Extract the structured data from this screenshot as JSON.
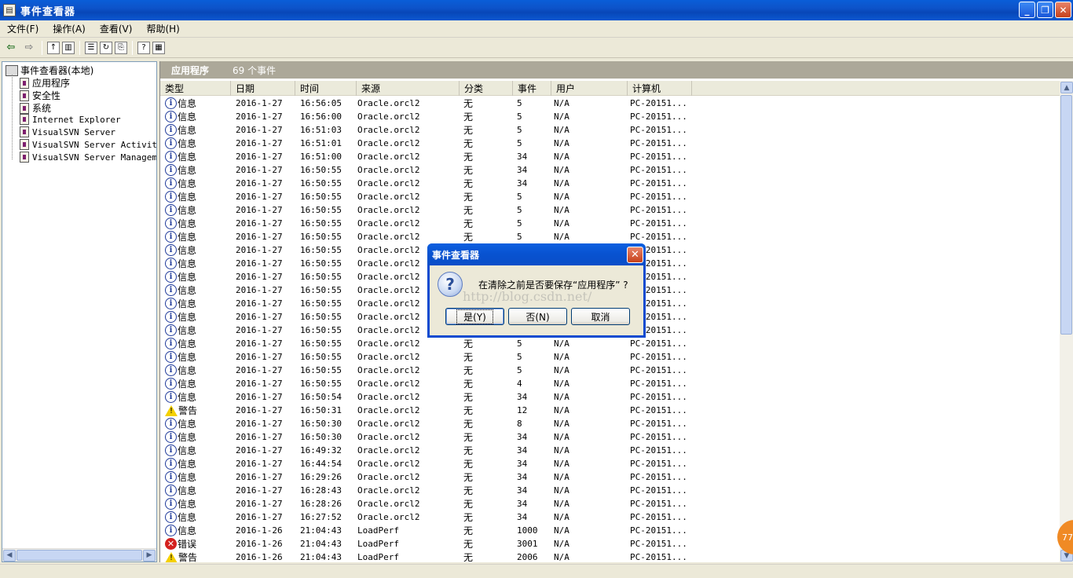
{
  "window": {
    "title": "事件查看器"
  },
  "menu": [
    "文件(F)",
    "操作(A)",
    "查看(V)",
    "帮助(H)"
  ],
  "toolbar": {
    "icons": [
      "back-arrow-icon",
      "forward-arrow-icon",
      "up-folder-icon",
      "show-hide-tree-icon",
      "properties-icon",
      "refresh-icon",
      "export-list-icon",
      "help-icon",
      "console-icon"
    ]
  },
  "tree": {
    "root": "事件查看器(本地)",
    "items": [
      "应用程序",
      "安全性",
      "系统",
      "Internet Explorer",
      "VisualSVN Server",
      "VisualSVN Server Activity",
      "VisualSVN Server Management"
    ]
  },
  "pane": {
    "title": "应用程序",
    "count": "69 个事件"
  },
  "columns": [
    "类型",
    "日期",
    "时间",
    "来源",
    "分类",
    "事件",
    "用户",
    "计算机"
  ],
  "rows": [
    {
      "type": "信息",
      "icon": "info",
      "date": "2016-1-27",
      "time": "16:56:05",
      "source": "Oracle.orcl2",
      "category": "无",
      "event": "5",
      "user": "N/A",
      "computer": "PC-20151..."
    },
    {
      "type": "信息",
      "icon": "info",
      "date": "2016-1-27",
      "time": "16:56:00",
      "source": "Oracle.orcl2",
      "category": "无",
      "event": "5",
      "user": "N/A",
      "computer": "PC-20151..."
    },
    {
      "type": "信息",
      "icon": "info",
      "date": "2016-1-27",
      "time": "16:51:03",
      "source": "Oracle.orcl2",
      "category": "无",
      "event": "5",
      "user": "N/A",
      "computer": "PC-20151..."
    },
    {
      "type": "信息",
      "icon": "info",
      "date": "2016-1-27",
      "time": "16:51:01",
      "source": "Oracle.orcl2",
      "category": "无",
      "event": "5",
      "user": "N/A",
      "computer": "PC-20151..."
    },
    {
      "type": "信息",
      "icon": "info",
      "date": "2016-1-27",
      "time": "16:51:00",
      "source": "Oracle.orcl2",
      "category": "无",
      "event": "34",
      "user": "N/A",
      "computer": "PC-20151..."
    },
    {
      "type": "信息",
      "icon": "info",
      "date": "2016-1-27",
      "time": "16:50:55",
      "source": "Oracle.orcl2",
      "category": "无",
      "event": "34",
      "user": "N/A",
      "computer": "PC-20151..."
    },
    {
      "type": "信息",
      "icon": "info",
      "date": "2016-1-27",
      "time": "16:50:55",
      "source": "Oracle.orcl2",
      "category": "无",
      "event": "34",
      "user": "N/A",
      "computer": "PC-20151..."
    },
    {
      "type": "信息",
      "icon": "info",
      "date": "2016-1-27",
      "time": "16:50:55",
      "source": "Oracle.orcl2",
      "category": "无",
      "event": "5",
      "user": "N/A",
      "computer": "PC-20151..."
    },
    {
      "type": "信息",
      "icon": "info",
      "date": "2016-1-27",
      "time": "16:50:55",
      "source": "Oracle.orcl2",
      "category": "无",
      "event": "5",
      "user": "N/A",
      "computer": "PC-20151..."
    },
    {
      "type": "信息",
      "icon": "info",
      "date": "2016-1-27",
      "time": "16:50:55",
      "source": "Oracle.orcl2",
      "category": "无",
      "event": "5",
      "user": "N/A",
      "computer": "PC-20151..."
    },
    {
      "type": "信息",
      "icon": "info",
      "date": "2016-1-27",
      "time": "16:50:55",
      "source": "Oracle.orcl2",
      "category": "无",
      "event": "5",
      "user": "N/A",
      "computer": "PC-20151..."
    },
    {
      "type": "信息",
      "icon": "info",
      "date": "2016-1-27",
      "time": "16:50:55",
      "source": "Oracle.orcl2",
      "category": "",
      "event": "",
      "user": "",
      "computer": "PC-20151..."
    },
    {
      "type": "信息",
      "icon": "info",
      "date": "2016-1-27",
      "time": "16:50:55",
      "source": "Oracle.orcl2",
      "category": "",
      "event": "",
      "user": "",
      "computer": "PC-20151..."
    },
    {
      "type": "信息",
      "icon": "info",
      "date": "2016-1-27",
      "time": "16:50:55",
      "source": "Oracle.orcl2",
      "category": "",
      "event": "",
      "user": "",
      "computer": "PC-20151..."
    },
    {
      "type": "信息",
      "icon": "info",
      "date": "2016-1-27",
      "time": "16:50:55",
      "source": "Oracle.orcl2",
      "category": "",
      "event": "",
      "user": "",
      "computer": "PC-20151..."
    },
    {
      "type": "信息",
      "icon": "info",
      "date": "2016-1-27",
      "time": "16:50:55",
      "source": "Oracle.orcl2",
      "category": "",
      "event": "",
      "user": "",
      "computer": "PC-20151..."
    },
    {
      "type": "信息",
      "icon": "info",
      "date": "2016-1-27",
      "time": "16:50:55",
      "source": "Oracle.orcl2",
      "category": "",
      "event": "",
      "user": "",
      "computer": "PC-20151..."
    },
    {
      "type": "信息",
      "icon": "info",
      "date": "2016-1-27",
      "time": "16:50:55",
      "source": "Oracle.orcl2",
      "category": "",
      "event": "",
      "user": "",
      "computer": "PC-20151..."
    },
    {
      "type": "信息",
      "icon": "info",
      "date": "2016-1-27",
      "time": "16:50:55",
      "source": "Oracle.orcl2",
      "category": "无",
      "event": "5",
      "user": "N/A",
      "computer": "PC-20151..."
    },
    {
      "type": "信息",
      "icon": "info",
      "date": "2016-1-27",
      "time": "16:50:55",
      "source": "Oracle.orcl2",
      "category": "无",
      "event": "5",
      "user": "N/A",
      "computer": "PC-20151..."
    },
    {
      "type": "信息",
      "icon": "info",
      "date": "2016-1-27",
      "time": "16:50:55",
      "source": "Oracle.orcl2",
      "category": "无",
      "event": "5",
      "user": "N/A",
      "computer": "PC-20151..."
    },
    {
      "type": "信息",
      "icon": "info",
      "date": "2016-1-27",
      "time": "16:50:55",
      "source": "Oracle.orcl2",
      "category": "无",
      "event": "4",
      "user": "N/A",
      "computer": "PC-20151..."
    },
    {
      "type": "信息",
      "icon": "info",
      "date": "2016-1-27",
      "time": "16:50:54",
      "source": "Oracle.orcl2",
      "category": "无",
      "event": "34",
      "user": "N/A",
      "computer": "PC-20151..."
    },
    {
      "type": "警告",
      "icon": "warn",
      "date": "2016-1-27",
      "time": "16:50:31",
      "source": "Oracle.orcl2",
      "category": "无",
      "event": "12",
      "user": "N/A",
      "computer": "PC-20151..."
    },
    {
      "type": "信息",
      "icon": "info",
      "date": "2016-1-27",
      "time": "16:50:30",
      "source": "Oracle.orcl2",
      "category": "无",
      "event": "8",
      "user": "N/A",
      "computer": "PC-20151..."
    },
    {
      "type": "信息",
      "icon": "info",
      "date": "2016-1-27",
      "time": "16:50:30",
      "source": "Oracle.orcl2",
      "category": "无",
      "event": "34",
      "user": "N/A",
      "computer": "PC-20151..."
    },
    {
      "type": "信息",
      "icon": "info",
      "date": "2016-1-27",
      "time": "16:49:32",
      "source": "Oracle.orcl2",
      "category": "无",
      "event": "34",
      "user": "N/A",
      "computer": "PC-20151..."
    },
    {
      "type": "信息",
      "icon": "info",
      "date": "2016-1-27",
      "time": "16:44:54",
      "source": "Oracle.orcl2",
      "category": "无",
      "event": "34",
      "user": "N/A",
      "computer": "PC-20151..."
    },
    {
      "type": "信息",
      "icon": "info",
      "date": "2016-1-27",
      "time": "16:29:26",
      "source": "Oracle.orcl2",
      "category": "无",
      "event": "34",
      "user": "N/A",
      "computer": "PC-20151..."
    },
    {
      "type": "信息",
      "icon": "info",
      "date": "2016-1-27",
      "time": "16:28:43",
      "source": "Oracle.orcl2",
      "category": "无",
      "event": "34",
      "user": "N/A",
      "computer": "PC-20151..."
    },
    {
      "type": "信息",
      "icon": "info",
      "date": "2016-1-27",
      "time": "16:28:26",
      "source": "Oracle.orcl2",
      "category": "无",
      "event": "34",
      "user": "N/A",
      "computer": "PC-20151..."
    },
    {
      "type": "信息",
      "icon": "info",
      "date": "2016-1-27",
      "time": "16:27:52",
      "source": "Oracle.orcl2",
      "category": "无",
      "event": "34",
      "user": "N/A",
      "computer": "PC-20151..."
    },
    {
      "type": "信息",
      "icon": "info",
      "date": "2016-1-26",
      "time": "21:04:43",
      "source": "LoadPerf",
      "category": "无",
      "event": "1000",
      "user": "N/A",
      "computer": "PC-20151..."
    },
    {
      "type": "错误",
      "icon": "err",
      "date": "2016-1-26",
      "time": "21:04:43",
      "source": "LoadPerf",
      "category": "无",
      "event": "3001",
      "user": "N/A",
      "computer": "PC-20151..."
    },
    {
      "type": "警告",
      "icon": "warn",
      "date": "2016-1-26",
      "time": "21:04:43",
      "source": "LoadPerf",
      "category": "无",
      "event": "2006",
      "user": "N/A",
      "computer": "PC-20151..."
    }
  ],
  "dialog": {
    "title": "事件查看器",
    "message": "在清除之前是否要保存“应用程序” ?",
    "watermark": "http://blog.csdn.net/",
    "yes": "是(Y)",
    "no": "否(N)",
    "cancel": "取消"
  },
  "badge": "77"
}
